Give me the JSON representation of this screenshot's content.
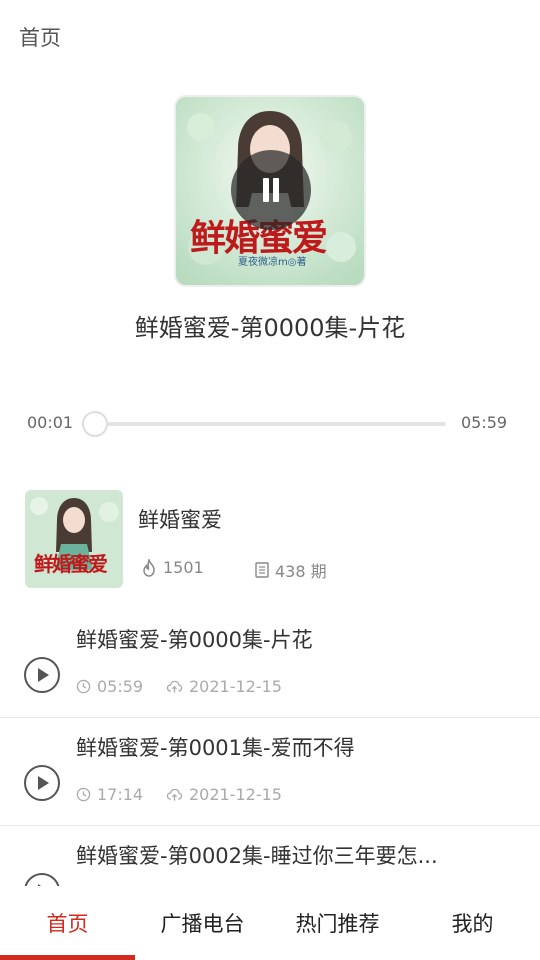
{
  "header": {
    "title": "首页"
  },
  "player": {
    "cover_icon": "book-cover-art",
    "cover_text": "鲜婚蜜爱",
    "cover_author": "夏夜微凉m◎著",
    "state_icon": "pause-icon",
    "track_title": "鲜婚蜜爱-第0000集-片花",
    "current_time": "00:01",
    "total_time": "05:59",
    "progress": 0.003
  },
  "album": {
    "name": "鲜婚蜜爱",
    "plays": "1501",
    "episodes": "438 期"
  },
  "episodes": [
    {
      "title": "鲜婚蜜爱-第0000集-片花",
      "duration": "05:59",
      "date": "2021-12-15"
    },
    {
      "title": "鲜婚蜜爱-第0001集-爱而不得",
      "duration": "17:14",
      "date": "2021-12-15"
    },
    {
      "title": "鲜婚蜜爱-第0002集-睡过你三年要怎...",
      "duration": "",
      "date": ""
    }
  ],
  "tabs": [
    {
      "label": "首页",
      "active": true
    },
    {
      "label": "广播电台",
      "active": false
    },
    {
      "label": "热门推荐",
      "active": false
    },
    {
      "label": "我的",
      "active": false
    }
  ],
  "colors": {
    "accent": "#cf2c1f",
    "text": "#333333",
    "muted": "#aaaaaa"
  }
}
